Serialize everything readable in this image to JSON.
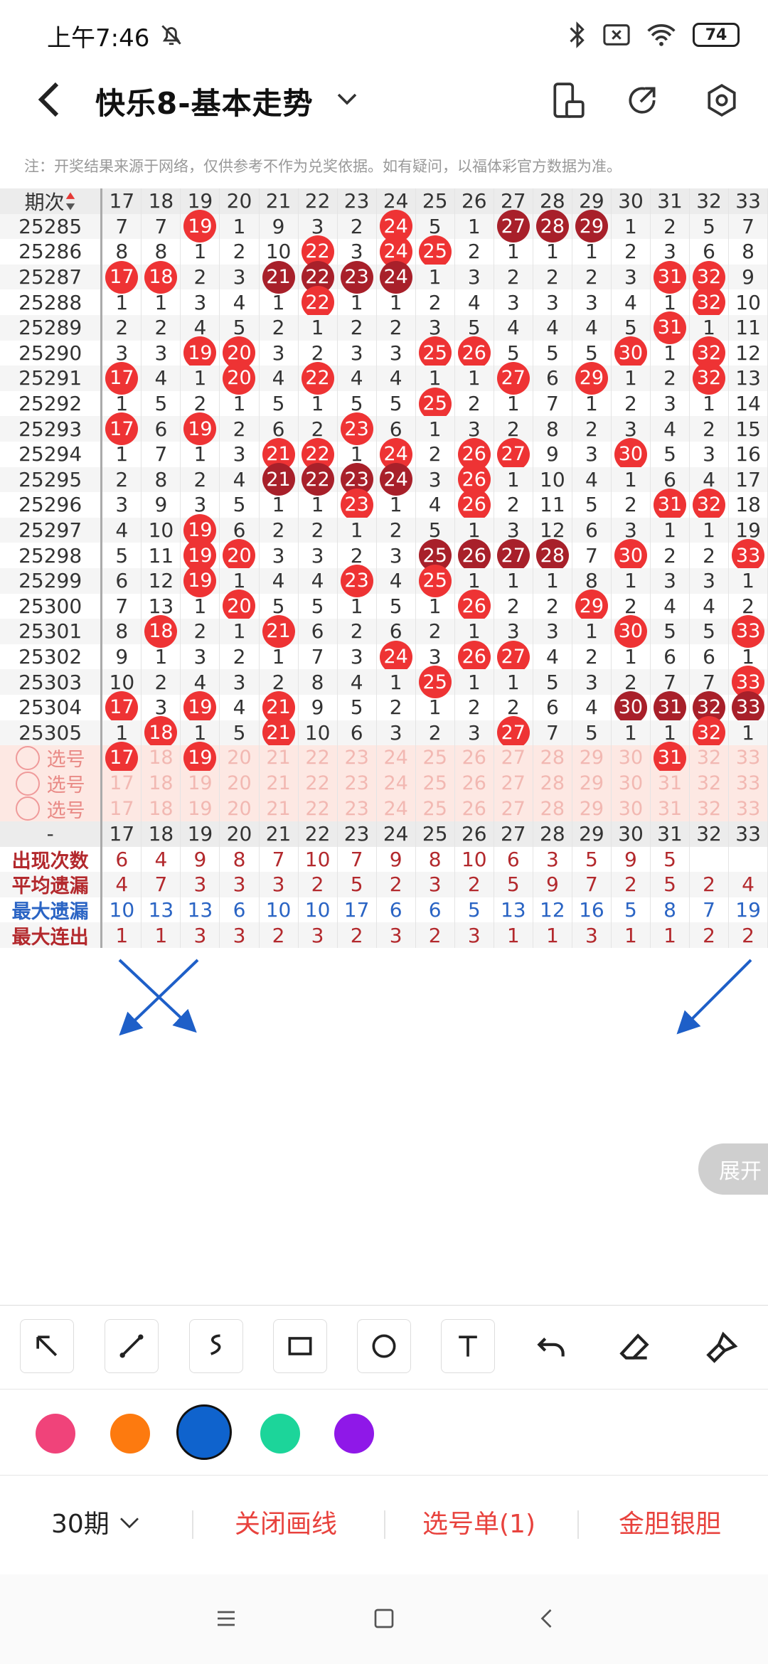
{
  "status_bar": {
    "time": "上午7:46",
    "battery": "74"
  },
  "header": {
    "title": "快乐8-基本走势"
  },
  "notice": "注：开奖结果来源于网络，仅供参考不作为兑奖依据。如有疑问，以福体彩官方数据为准。",
  "table": {
    "period_header": "期次",
    "columns": [
      "17",
      "18",
      "19",
      "20",
      "21",
      "22",
      "23",
      "24",
      "25",
      "26",
      "27",
      "28",
      "29",
      "30",
      "31",
      "32",
      "33"
    ],
    "rows": [
      {
        "period": "25285",
        "cells": [
          "7",
          "7",
          "19",
          "1",
          "9",
          "3",
          "2",
          "24",
          "5",
          "1",
          "27",
          "28",
          "29",
          "1",
          "2",
          "5",
          "7"
        ],
        "styles": [
          "",
          "",
          "r",
          "",
          "",
          "",
          "",
          "r",
          "",
          "",
          "d",
          "d",
          "d",
          "",
          "",
          "",
          ""
        ]
      },
      {
        "period": "25286",
        "cells": [
          "8",
          "8",
          "1",
          "2",
          "10",
          "22",
          "3",
          "24",
          "25",
          "2",
          "1",
          "1",
          "1",
          "2",
          "3",
          "6",
          "8"
        ],
        "styles": [
          "",
          "",
          "",
          "",
          "",
          "r",
          "",
          "r",
          "r",
          "",
          "",
          "",
          "",
          "",
          "",
          "",
          ""
        ]
      },
      {
        "period": "25287",
        "cells": [
          "17",
          "18",
          "2",
          "3",
          "21",
          "22",
          "23",
          "24",
          "1",
          "3",
          "2",
          "2",
          "2",
          "3",
          "31",
          "32",
          "9"
        ],
        "styles": [
          "r",
          "r",
          "",
          "",
          "d",
          "d",
          "d",
          "d",
          "",
          "",
          "",
          "",
          "",
          "",
          "r",
          "r",
          ""
        ]
      },
      {
        "period": "25288",
        "cells": [
          "1",
          "1",
          "3",
          "4",
          "1",
          "22",
          "1",
          "1",
          "2",
          "4",
          "3",
          "3",
          "3",
          "4",
          "1",
          "32",
          "10"
        ],
        "styles": [
          "",
          "",
          "",
          "",
          "",
          "r",
          "",
          "",
          "",
          "",
          "",
          "",
          "",
          "",
          "",
          "r",
          ""
        ]
      },
      {
        "period": "25289",
        "cells": [
          "2",
          "2",
          "4",
          "5",
          "2",
          "1",
          "2",
          "2",
          "3",
          "5",
          "4",
          "4",
          "4",
          "5",
          "31",
          "1",
          "11"
        ],
        "styles": [
          "",
          "",
          "",
          "",
          "",
          "",
          "",
          "",
          "",
          "",
          "",
          "",
          "",
          "",
          "r",
          "",
          ""
        ]
      },
      {
        "period": "25290",
        "cells": [
          "3",
          "3",
          "19",
          "20",
          "3",
          "2",
          "3",
          "3",
          "25",
          "26",
          "5",
          "5",
          "5",
          "30",
          "1",
          "32",
          "12"
        ],
        "styles": [
          "",
          "",
          "r",
          "r",
          "",
          "",
          "",
          "",
          "r",
          "r",
          "",
          "",
          "",
          "r",
          "",
          "r",
          ""
        ]
      },
      {
        "period": "25291",
        "cells": [
          "17",
          "4",
          "1",
          "20",
          "4",
          "22",
          "4",
          "4",
          "1",
          "1",
          "27",
          "6",
          "29",
          "1",
          "2",
          "32",
          "13"
        ],
        "styles": [
          "r",
          "",
          "",
          "r",
          "",
          "r",
          "",
          "",
          "",
          "",
          "r",
          "",
          "r",
          "",
          "",
          "r",
          ""
        ]
      },
      {
        "period": "25292",
        "cells": [
          "1",
          "5",
          "2",
          "1",
          "5",
          "1",
          "5",
          "5",
          "25",
          "2",
          "1",
          "7",
          "1",
          "2",
          "3",
          "1",
          "14"
        ],
        "styles": [
          "",
          "",
          "",
          "",
          "",
          "",
          "",
          "",
          "r",
          "",
          "",
          "",
          "",
          "",
          "",
          "",
          ""
        ]
      },
      {
        "period": "25293",
        "cells": [
          "17",
          "6",
          "19",
          "2",
          "6",
          "2",
          "23",
          "6",
          "1",
          "3",
          "2",
          "8",
          "2",
          "3",
          "4",
          "2",
          "15"
        ],
        "styles": [
          "r",
          "",
          "r",
          "",
          "",
          "",
          "r",
          "",
          "",
          "",
          "",
          "",
          "",
          "",
          "",
          "",
          ""
        ]
      },
      {
        "period": "25294",
        "cells": [
          "1",
          "7",
          "1",
          "3",
          "21",
          "22",
          "1",
          "24",
          "2",
          "26",
          "27",
          "9",
          "3",
          "30",
          "5",
          "3",
          "16"
        ],
        "styles": [
          "",
          "",
          "",
          "",
          "r",
          "r",
          "",
          "r",
          "",
          "r",
          "r",
          "",
          "",
          "r",
          "",
          "",
          ""
        ]
      },
      {
        "period": "25295",
        "cells": [
          "2",
          "8",
          "2",
          "4",
          "21",
          "22",
          "23",
          "24",
          "3",
          "26",
          "1",
          "10",
          "4",
          "1",
          "6",
          "4",
          "17"
        ],
        "styles": [
          "",
          "",
          "",
          "",
          "d",
          "d",
          "d",
          "d",
          "",
          "r",
          "",
          "",
          "",
          "",
          "",
          "",
          ""
        ]
      },
      {
        "period": "25296",
        "cells": [
          "3",
          "9",
          "3",
          "5",
          "1",
          "1",
          "23",
          "1",
          "4",
          "26",
          "2",
          "11",
          "5",
          "2",
          "31",
          "32",
          "18"
        ],
        "styles": [
          "",
          "",
          "",
          "",
          "",
          "",
          "r",
          "",
          "",
          "r",
          "",
          "",
          "",
          "",
          "r",
          "r",
          ""
        ]
      },
      {
        "period": "25297",
        "cells": [
          "4",
          "10",
          "19",
          "6",
          "2",
          "2",
          "1",
          "2",
          "5",
          "1",
          "3",
          "12",
          "6",
          "3",
          "1",
          "1",
          "19"
        ],
        "styles": [
          "",
          "",
          "r",
          "",
          "",
          "",
          "",
          "",
          "",
          "",
          "",
          "",
          "",
          "",
          "",
          "",
          ""
        ]
      },
      {
        "period": "25298",
        "cells": [
          "5",
          "11",
          "19",
          "20",
          "3",
          "3",
          "2",
          "3",
          "25",
          "26",
          "27",
          "28",
          "7",
          "30",
          "2",
          "2",
          "33"
        ],
        "styles": [
          "",
          "",
          "r",
          "r",
          "",
          "",
          "",
          "",
          "d",
          "d",
          "d",
          "d",
          "",
          "r",
          "",
          "",
          "r"
        ]
      },
      {
        "period": "25299",
        "cells": [
          "6",
          "12",
          "19",
          "1",
          "4",
          "4",
          "23",
          "4",
          "25",
          "1",
          "1",
          "1",
          "8",
          "1",
          "3",
          "3",
          "1"
        ],
        "styles": [
          "",
          "",
          "r",
          "",
          "",
          "",
          "r",
          "",
          "r",
          "",
          "",
          "",
          "",
          "",
          "",
          "",
          ""
        ]
      },
      {
        "period": "25300",
        "cells": [
          "7",
          "13",
          "1",
          "20",
          "5",
          "5",
          "1",
          "5",
          "1",
          "26",
          "2",
          "2",
          "29",
          "2",
          "4",
          "4",
          "2"
        ],
        "styles": [
          "",
          "",
          "",
          "r",
          "",
          "",
          "",
          "",
          "",
          "r",
          "",
          "",
          "r",
          "",
          "",
          "",
          ""
        ]
      },
      {
        "period": "25301",
        "cells": [
          "8",
          "18",
          "2",
          "1",
          "21",
          "6",
          "2",
          "6",
          "2",
          "1",
          "3",
          "3",
          "1",
          "30",
          "5",
          "5",
          "33"
        ],
        "styles": [
          "",
          "r",
          "",
          "",
          "r",
          "",
          "",
          "",
          "",
          "",
          "",
          "",
          "",
          "r",
          "",
          "",
          "r"
        ]
      },
      {
        "period": "25302",
        "cells": [
          "9",
          "1",
          "3",
          "2",
          "1",
          "7",
          "3",
          "24",
          "3",
          "26",
          "27",
          "4",
          "2",
          "1",
          "6",
          "6",
          "1"
        ],
        "styles": [
          "",
          "",
          "",
          "",
          "",
          "",
          "",
          "r",
          "",
          "r",
          "r",
          "",
          "",
          "",
          "",
          "",
          ""
        ]
      },
      {
        "period": "25303",
        "cells": [
          "10",
          "2",
          "4",
          "3",
          "2",
          "8",
          "4",
          "1",
          "25",
          "1",
          "1",
          "5",
          "3",
          "2",
          "7",
          "7",
          "33"
        ],
        "styles": [
          "",
          "",
          "",
          "",
          "",
          "",
          "",
          "",
          "r",
          "",
          "",
          "",
          "",
          "",
          "",
          "",
          "r"
        ]
      },
      {
        "period": "25304",
        "cells": [
          "17",
          "3",
          "19",
          "4",
          "21",
          "9",
          "5",
          "2",
          "1",
          "2",
          "2",
          "6",
          "4",
          "30",
          "31",
          "32",
          "33"
        ],
        "styles": [
          "r",
          "",
          "r",
          "",
          "r",
          "",
          "",
          "",
          "",
          "",
          "",
          "",
          "",
          "d",
          "d",
          "d",
          "d"
        ]
      },
      {
        "period": "25305",
        "cells": [
          "1",
          "18",
          "1",
          "5",
          "21",
          "10",
          "6",
          "3",
          "2",
          "3",
          "27",
          "7",
          "5",
          "1",
          "1",
          "32",
          "1"
        ],
        "styles": [
          "",
          "r",
          "",
          "",
          "r",
          "",
          "",
          "",
          "",
          "",
          "r",
          "",
          "",
          "",
          "",
          "r",
          ""
        ]
      }
    ],
    "pick_rows": [
      {
        "label": "选号",
        "selected": [
          "17",
          "19",
          "31"
        ]
      },
      {
        "label": "选号",
        "selected": []
      },
      {
        "label": "选号",
        "selected": []
      }
    ],
    "stats_header": "-",
    "stats": [
      {
        "label": "出现次数",
        "color": "#b3292d",
        "values": [
          "6",
          "4",
          "9",
          "8",
          "7",
          "10",
          "7",
          "9",
          "8",
          "10",
          "6",
          "3",
          "5",
          "9",
          "5",
          "",
          ""
        ]
      },
      {
        "label": "平均遗漏",
        "color": "#b3292d",
        "values": [
          "4",
          "7",
          "3",
          "3",
          "3",
          "2",
          "5",
          "2",
          "3",
          "2",
          "5",
          "9",
          "7",
          "2",
          "5",
          "2",
          "4"
        ]
      },
      {
        "label": "最大遗漏",
        "color": "#2a64c4",
        "values": [
          "10",
          "13",
          "13",
          "6",
          "10",
          "10",
          "17",
          "6",
          "6",
          "5",
          "13",
          "12",
          "16",
          "5",
          "8",
          "7",
          "19"
        ]
      },
      {
        "label": "最大连出",
        "color": "#b3292d",
        "values": [
          "1",
          "1",
          "3",
          "3",
          "2",
          "3",
          "2",
          "3",
          "2",
          "3",
          "1",
          "1",
          "3",
          "1",
          "1",
          "2",
          "2"
        ]
      }
    ],
    "expand_label": "展开"
  },
  "colors": {
    "pink": "#f0437a",
    "orange": "#fd7a0f",
    "blue": "#0f63cd",
    "green": "#1cd59a",
    "purple": "#8f18e8",
    "arrow": "#1e5fc8"
  },
  "bottom_bar": {
    "period_select": "30期",
    "close_lines": "关闭画线",
    "pick_list": "选号单(1)",
    "gold_silver": "金胆银胆"
  }
}
